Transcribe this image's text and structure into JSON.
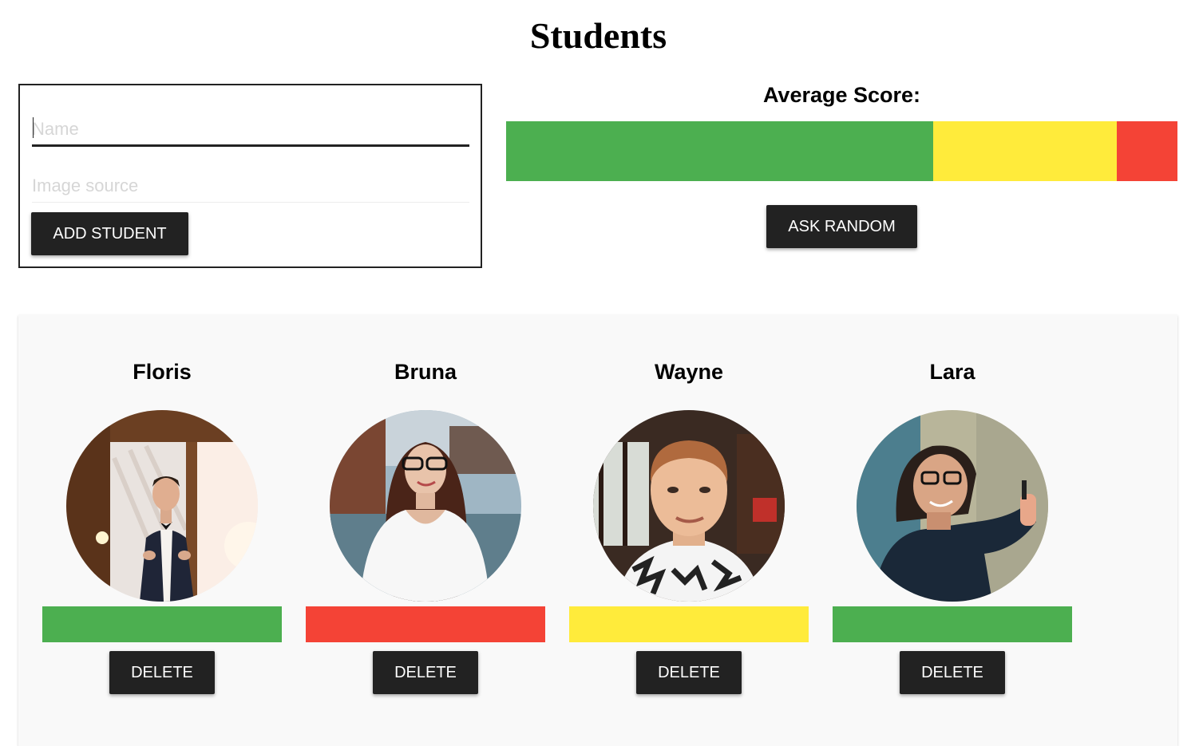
{
  "page": {
    "title": "Students"
  },
  "form": {
    "name_placeholder": "Name",
    "name_value": "",
    "image_placeholder": "Image source",
    "image_value": "",
    "add_button_label": "ADD STUDENT"
  },
  "average": {
    "label": "Average Score:",
    "segments": [
      {
        "color": "#4caf50",
        "share": 0.636
      },
      {
        "color": "#ffeb3b",
        "share": 0.274
      },
      {
        "color": "#f44336",
        "share": 0.09
      }
    ],
    "ask_button_label": "ASK RANDOM"
  },
  "colors": {
    "green": "#4caf50",
    "yellow": "#ffeb3b",
    "red": "#f44336",
    "button": "#222222",
    "panel": "#f9f9f9"
  },
  "students": [
    {
      "name": "Floris",
      "score_color": "#4caf50",
      "delete_label": "DELETE",
      "avatar": "photo of man in tuxedo"
    },
    {
      "name": "Bruna",
      "score_color": "#f44336",
      "delete_label": "DELETE",
      "avatar": "photo of woman with glasses by harbor"
    },
    {
      "name": "Wayne",
      "score_color": "#ffeb3b",
      "delete_label": "DELETE",
      "avatar": "photo of man in patterned shirt"
    },
    {
      "name": "Lara",
      "score_color": "#4caf50",
      "delete_label": "DELETE",
      "avatar": "photo of woman with glasses pointing at wall"
    }
  ]
}
